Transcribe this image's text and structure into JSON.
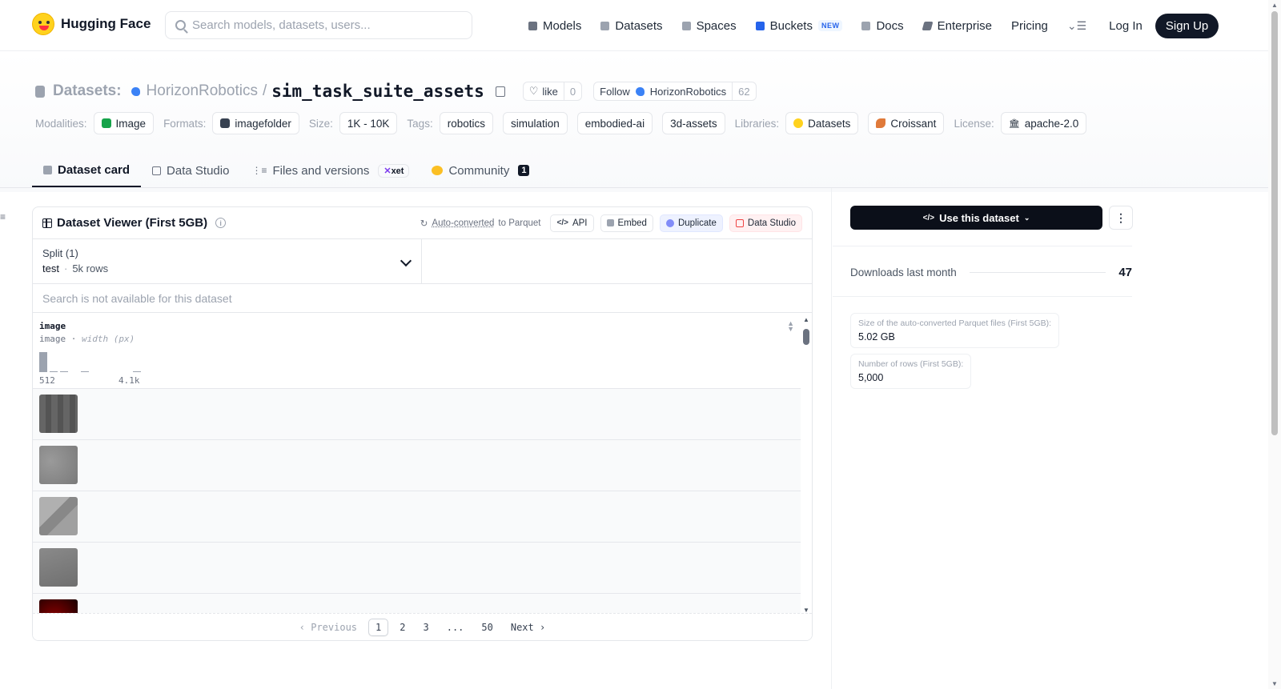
{
  "nav": {
    "brand": "Hugging Face",
    "search_placeholder": "Search models, datasets, users...",
    "links": [
      {
        "label": "Models",
        "icon": "cube-icon",
        "color": "#6b7280"
      },
      {
        "label": "Datasets",
        "icon": "database-icon",
        "color": "#9ca3af"
      },
      {
        "label": "Spaces",
        "icon": "spaces-grid-icon",
        "color": "#9ca3af"
      },
      {
        "label": "Buckets",
        "icon": "bucket-icon",
        "color": "#2563eb"
      },
      {
        "label": "Docs",
        "icon": "book-icon",
        "color": "#9ca3af"
      },
      {
        "label": "Enterprise",
        "icon": "enterprise-icon",
        "color": "#6b7280"
      },
      {
        "label": "Pricing"
      }
    ],
    "new_badge": "NEW",
    "login": "Log In",
    "signup": "Sign Up"
  },
  "header": {
    "section": "Datasets:",
    "org": "HorizonRobotics",
    "separator": "/",
    "repo": "sim_task_suite_assets",
    "like_label": "like",
    "like_count": "0",
    "follow_label": "Follow",
    "follow_org": "HorizonRobotics",
    "follower_count": "62"
  },
  "meta": {
    "modalities_label": "Modalities:",
    "modality": "Image",
    "formats_label": "Formats:",
    "format": "imagefolder",
    "size_label": "Size:",
    "size": "1K - 10K",
    "tags_label": "Tags:",
    "tags": [
      "robotics",
      "simulation",
      "embodied-ai",
      "3d-assets"
    ],
    "libraries_label": "Libraries:",
    "libraries": [
      "Datasets",
      "Croissant"
    ],
    "license_label": "License:",
    "license": "apache-2.0"
  },
  "tabs": {
    "dataset_card": "Dataset card",
    "data_studio": "Data Studio",
    "files": "Files and versions",
    "xet": "xet",
    "community": "Community",
    "community_count": "1"
  },
  "viewer": {
    "title": "Dataset Viewer (First 5GB)",
    "auto_converted": "Auto-converted",
    "auto_converted_suffix": "to Parquet",
    "api": "API",
    "embed": "Embed",
    "duplicate": "Duplicate",
    "data_studio": "Data Studio",
    "split_label": "Split (1)",
    "split_name": "test",
    "split_rows": "5k rows",
    "search_na": "Search is not available for this dataset",
    "column_name": "image",
    "column_type": "image",
    "column_stat": "width (px)",
    "hist_min": "512",
    "hist_max": "4.1k",
    "hist_values": [
      0.95,
      0.04,
      0.04,
      0,
      0.03,
      0,
      0,
      0,
      0,
      0.02
    ],
    "pager": {
      "previous": "Previous",
      "pages": [
        "1",
        "2",
        "3",
        "...",
        "50"
      ],
      "next": "Next"
    }
  },
  "sidebar": {
    "use_dataset": "Use this dataset",
    "downloads_label": "Downloads last month",
    "downloads_value": "47",
    "parquet_size_label": "Size of the auto-converted Parquet files (First 5GB):",
    "parquet_size_value": "5.02 GB",
    "rows_label": "Number of rows (First 5GB):",
    "rows_value": "5,000"
  }
}
